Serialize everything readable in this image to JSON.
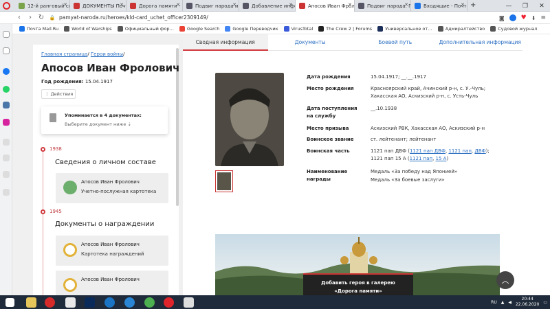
{
  "browser": {
    "tabs": [
      {
        "label": "12-й ранговый спр…",
        "color": "#7aa34a"
      },
      {
        "label": "ДОКУМЕНТЫ Почт…",
        "color": "#c33"
      },
      {
        "label": "Дорога памяти - н…",
        "color": "#c33"
      },
      {
        "label": "Подвиг народа и б…",
        "color": "#556"
      },
      {
        "label": "Добавление инфо…",
        "color": "#556"
      },
      {
        "label": "Апосов Иван Фрол…",
        "color": "#c33"
      },
      {
        "label": "Подвиг народа. П…",
        "color": "#556"
      },
      {
        "label": "Входящие - Почта…",
        "color": "#1a73e8"
      }
    ],
    "url": "pamyat-naroda.ru/heroes/kld-card_uchet_officer2309149/",
    "bookmarks": [
      {
        "label": "Почта Mail.Ru",
        "color": "#1a73e8"
      },
      {
        "label": "World of Warships",
        "color": "#555"
      },
      {
        "label": "Официальный фор…",
        "color": "#555"
      },
      {
        "label": "Google Search",
        "color": "#ea4335"
      },
      {
        "label": "Google Переводчик",
        "color": "#4285f4"
      },
      {
        "label": "VirusTotal",
        "color": "#3b5bdb"
      },
      {
        "label": "The Crew 2 | Forums",
        "color": "#222"
      },
      {
        "label": "Универсальное от…",
        "color": "#1c2f5a"
      },
      {
        "label": "Адмиралтейство",
        "color": "#555"
      },
      {
        "label": "Судовой журнал",
        "color": "#555"
      }
    ]
  },
  "left": {
    "crumb_home": "Главная страница",
    "crumb_sep": "/",
    "crumb_section": "Герои войны",
    "name": "Апосов Иван Фролович",
    "birth_label": "Год рождения:",
    "birth_value": "15.04.1917",
    "actions": "⋮ Действия",
    "mentions_title": "Упоминается в 4 документах:",
    "mentions_sub": "Выберите документ ниже ⇣",
    "timeline": [
      {
        "year": "1938",
        "heading": "Сведения о личном составе",
        "cards": [
          {
            "name": "Апосов Иван Фролович",
            "type": "Учетно-послужная картотека"
          }
        ]
      },
      {
        "year": "1945",
        "heading": "Документы о награждении",
        "cards": [
          {
            "name": "Апосов Иван Фролович",
            "type": "Картотека награждений"
          },
          {
            "name": "Апосов Иван Фролович",
            "type": ""
          }
        ]
      }
    ]
  },
  "right": {
    "tabs": [
      "Сводная информация",
      "Документы",
      "Боевой путь",
      "Дополнительная информация"
    ],
    "fields": {
      "birth_date_label": "Дата рождения",
      "birth_date_value": "15.04.1917; __.__.1917",
      "birth_place_label": "Место рождения",
      "birth_place_value": "Красноярский край, Ачинский р-н, с. У.-Чуль; Хакасская АО, Аскизский р-н, с. Усть-Чуль",
      "entry_label": "Дата поступления на службу",
      "entry_value": "__.10.1938",
      "draft_label": "Место призыва",
      "draft_value": "Аскизский РВК, Хакасская АО, Аскизский р-н",
      "rank_label": "Воинское звание",
      "rank_value": "ст. лейтенант; лейтенант",
      "unit_label": "Воинская часть",
      "unit_p1": "1121 пап ДВФ (",
      "unit_l1": "1121 пап ДВФ",
      "unit_l2": "1121 пап",
      "unit_l3": "ДВФ",
      "unit_p2": "1121 пап 15 А (",
      "unit_l4": "1121 пап",
      "unit_l5": "15 А",
      "awards_label": "Наименование награды",
      "award1": "Медаль «За победу над Японией»",
      "award2": "Медаль «За боевые заслуги»"
    },
    "banner_line1": "Добавить героя в галерею",
    "banner_line2": "«Дорога памяти»"
  },
  "taskbar": {
    "lang": "RU",
    "time": "20:44",
    "date": "22.06.2020"
  }
}
